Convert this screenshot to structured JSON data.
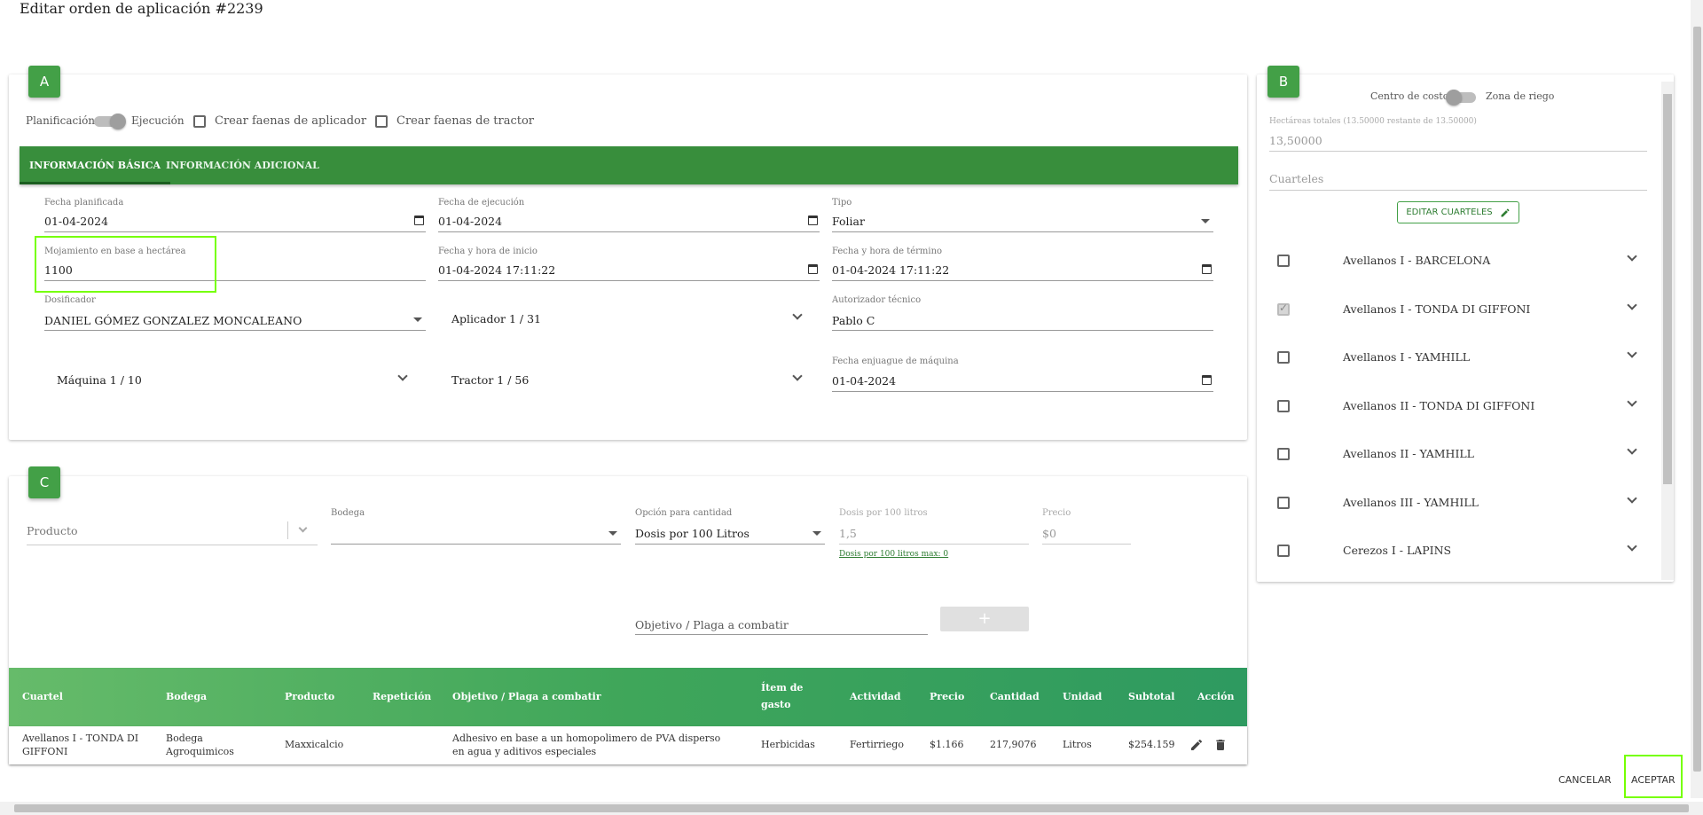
{
  "title": "Editar orden de aplicación #2239",
  "cards": {
    "a": "A",
    "b": "B",
    "c": "C"
  },
  "toggles": {
    "planificacion": "Planificación",
    "ejecucion": "Ejecución",
    "crear_aplicador": "Crear faenas de aplicador",
    "crear_tractor": "Crear faenas de tractor"
  },
  "tabs": [
    "INFORMACIÓN BÁSICA",
    "INFORMACIÓN ADICIONAL"
  ],
  "fields": {
    "fecha_planificada": {
      "label": "Fecha planificada",
      "value": "01-04-2024"
    },
    "fecha_ejecucion": {
      "label": "Fecha de ejecución",
      "value": "01-04-2024"
    },
    "tipo": {
      "label": "Tipo",
      "value": "Foliar"
    },
    "mojamiento": {
      "label": "Mojamiento en base a hectárea",
      "value": "1100"
    },
    "fecha_inicio": {
      "label": "Fecha y hora de inicio",
      "value": "01-04-2024 17:11:22"
    },
    "fecha_termino": {
      "label": "Fecha y hora de término",
      "value": "01-04-2024 17:11:22"
    },
    "dosificador": {
      "label": "Dosificador",
      "value": "DANIEL GÓMEZ GONZALEZ MONCALEANO"
    },
    "aplicador": {
      "value": "Aplicador 1 / 31"
    },
    "autorizador": {
      "label": "Autorizador técnico",
      "value": "Pablo C"
    },
    "maquina": {
      "value": "Máquina 1 / 10"
    },
    "tractor": {
      "value": "Tractor 1 / 56"
    },
    "fecha_enjuague": {
      "label": "Fecha enjuague de máquina",
      "value": "01-04-2024"
    }
  },
  "side": {
    "centro_costo": "Centro de costo",
    "zona_riego": "Zona de riego",
    "hectareas_label": "Hectáreas totales (13.50000 restante de 13.50000)",
    "hectareas_value": "13,50000",
    "cuarteles_placeholder": "Cuarteles",
    "editar_cuarteles": "EDITAR CUARTELES",
    "cuarteles": [
      {
        "label": "Avellanos I - BARCELONA",
        "checked": false
      },
      {
        "label": "Avellanos I - TONDA DI GIFFONI",
        "checked": true
      },
      {
        "label": "Avellanos I - YAMHILL",
        "checked": false
      },
      {
        "label": "Avellanos II - TONDA DI GIFFONI",
        "checked": false
      },
      {
        "label": "Avellanos II - YAMHILL",
        "checked": false
      },
      {
        "label": "Avellanos III - YAMHILL",
        "checked": false
      },
      {
        "label": "Cerezos I - LAPINS",
        "checked": false
      }
    ]
  },
  "product_form": {
    "producto_placeholder": "Producto",
    "bodega_label": "Bodega",
    "opcion_label": "Opción para cantidad",
    "opcion_value": "Dosis por 100 Litros",
    "dosis_label": "Dosis por 100 litros",
    "dosis_value": "1,5",
    "dosis_hint": "Dosis por 100 litros max: 0",
    "precio_label": "Precio",
    "precio_value": "$0",
    "objetivo_placeholder": "Objetivo / Plaga a combatir",
    "add_symbol": "+"
  },
  "table": {
    "headers": [
      "Cuartel",
      "Bodega",
      "Producto",
      "Repetición",
      "Objetivo / Plaga a combatir",
      "Ítem de gasto",
      "Actividad",
      "Precio",
      "Cantidad",
      "Unidad",
      "Subtotal",
      "Acción"
    ],
    "rows": [
      {
        "cuartel": "Avellanos I - TONDA DI GIFFONI",
        "bodega": "Bodega Agroquimicos",
        "producto": "Maxxicalcio",
        "repeticion": "",
        "objetivo": "Adhesivo en base a un homopolimero de PVA disperso en agua y aditivos especiales",
        "item": "Herbicidas",
        "actividad": "Fertirriego",
        "precio": "$1.166",
        "cantidad": "217,9076",
        "unidad": "Litros",
        "subtotal": "$254.159"
      }
    ]
  },
  "footer": {
    "cancel": "CANCELAR",
    "accept": "ACEPTAR"
  },
  "colors": {
    "primary": "#388e3c",
    "badge": "#43a047",
    "highlight": "#76ff03"
  }
}
